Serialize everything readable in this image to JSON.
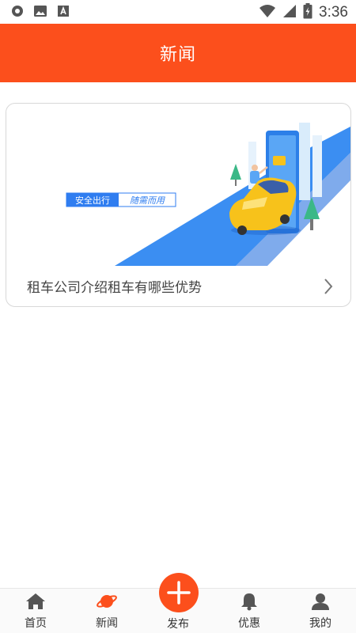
{
  "status_bar": {
    "time": "3:36",
    "left_icons": [
      "record-icon",
      "image-icon",
      "font-icon"
    ],
    "right_icons": [
      "wifi-icon",
      "signal-icon",
      "battery-charging-icon"
    ]
  },
  "header": {
    "title": "新闻"
  },
  "news": {
    "items": [
      {
        "title": "租车公司介绍租车有哪些优势",
        "banner_tag_left": "安全出行",
        "banner_tag_right": "随需而用"
      }
    ]
  },
  "bottom_nav": {
    "items": [
      {
        "label": "首页",
        "icon": "home-icon"
      },
      {
        "label": "新闻",
        "icon": "planet-icon",
        "active": true
      },
      {
        "label": "发布",
        "icon": "plus-icon"
      },
      {
        "label": "优惠",
        "icon": "bell-icon"
      },
      {
        "label": "我的",
        "icon": "user-icon"
      }
    ]
  },
  "colors": {
    "accent": "#fc4f1c",
    "banner_blue": "#2f7df0",
    "car_yellow": "#f7c21b"
  }
}
